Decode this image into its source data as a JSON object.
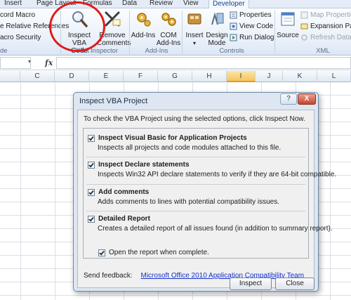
{
  "ribbon_tabs": [
    "Insert",
    "Page Layout",
    "Formulas",
    "Data",
    "Review",
    "View",
    "Developer"
  ],
  "code_group": {
    "record_macro": "cord Macro",
    "relative_refs": "e Relative References",
    "macro_security": "acro Security",
    "label": "de"
  },
  "inspector_group": {
    "inspect_line1": "Inspect",
    "inspect_line2": "VBA Code",
    "remove_line1": "Remove",
    "remove_line2": "Comments",
    "label": "VBA Inspector"
  },
  "addins_group": {
    "addins_line1": "Add-Ins",
    "com_line1": "COM",
    "com_line2": "Add-Ins",
    "label": "Add-Ins"
  },
  "controls_group": {
    "insert": "Insert",
    "design_line1": "Design",
    "design_line2": "Mode",
    "properties": "Properties",
    "view_code": "View Code",
    "run_dialog": "Run Dialog",
    "label": "Controls"
  },
  "xml_group": {
    "source": "Source",
    "map_properties": "Map Properties",
    "expansion_packs": "Expansion Packs",
    "refresh_data": "Refresh Data",
    "label": "XML"
  },
  "formula_bar": {
    "fx": "fx",
    "namebox": ""
  },
  "columns": [
    "C",
    "D",
    "E",
    "F",
    "G",
    "H",
    "I",
    "J",
    "K",
    "L"
  ],
  "selected_column": "I",
  "dialog": {
    "title": "Inspect VBA Project",
    "help_button": "?",
    "close_button": "X",
    "intro": "To check the VBA Project using the selected options, click Inspect Now.",
    "options": [
      {
        "label": "Inspect Visual Basic for Application Projects",
        "desc": "Inspects all projects and code modules attached to this file.",
        "checked": true
      },
      {
        "label": "Inspect Declare statements",
        "desc": "Inspects Win32 API declare statements to verify if they are 64-bit compatible.",
        "checked": true
      },
      {
        "label": "Add comments",
        "desc": "Adds comments to lines with potential compatibility issues.",
        "checked": true
      },
      {
        "label": "Detailed Report",
        "desc": "Creates a detailed report of all issues found (in addition to summary report).",
        "checked": true
      }
    ],
    "open_report": "Open the report when complete.",
    "feedback_label": "Send feedback:",
    "feedback_link": "Microsoft Office 2010 Application Compatibility Team",
    "inspect_button": "Inspect",
    "close_label": "Close"
  },
  "colors": {
    "ribbon_bg": "#e9f0f9",
    "selected_column": "#f6c55e",
    "annotation_circle": "#e01b1b",
    "link": "#1530c8",
    "dialog_frame": "#dde6f1"
  }
}
